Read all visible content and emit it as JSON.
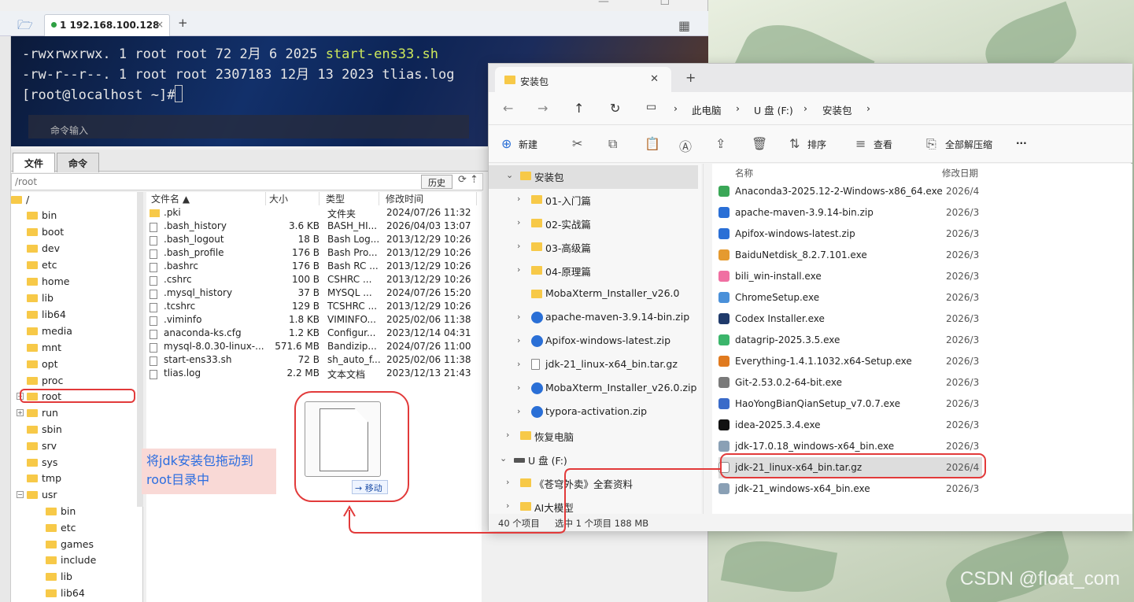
{
  "moba": {
    "tab_title": "1 192.168.100.128",
    "terminal_lines": [
      {
        "perm": "-rwxrwxrwx.",
        "links": "1",
        "user": "root",
        "group": "root",
        "size": "72",
        "month": "2月",
        "day": "6",
        "year": "2025",
        "name": "start-ens33.sh"
      },
      {
        "perm": "-rw-r--r--.",
        "links": "1",
        "user": "root",
        "group": "root",
        "size": "2307183",
        "month": "12月",
        "day": "13",
        "year": "2023",
        "name": "tlias.log"
      }
    ],
    "prompt": "[root@localhost ~]#",
    "command_input": "命令输入",
    "lower_tabs": [
      "文件",
      "命令"
    ],
    "path": "/root",
    "history_button": "历史",
    "tree": [
      "/",
      "bin",
      "boot",
      "dev",
      "etc",
      "home",
      "lib",
      "lib64",
      "media",
      "mnt",
      "opt",
      "proc",
      "root",
      "run",
      "sbin",
      "srv",
      "sys",
      "tmp",
      "usr",
      "bin",
      "etc",
      "games",
      "include",
      "lib",
      "lib64"
    ],
    "file_headers": [
      "文件名 ▲",
      "大小",
      "类型",
      "修改时间"
    ],
    "files": [
      {
        "name": ".pki",
        "size": "",
        "type": "文件夹",
        "time": "2024/07/26 11:32"
      },
      {
        "name": ".bash_history",
        "size": "3.6 KB",
        "type": "BASH_HI...",
        "time": "2026/04/03 13:07"
      },
      {
        "name": ".bash_logout",
        "size": "18 B",
        "type": "Bash Log...",
        "time": "2013/12/29 10:26"
      },
      {
        "name": ".bash_profile",
        "size": "176 B",
        "type": "Bash Pro...",
        "time": "2013/12/29 10:26"
      },
      {
        "name": ".bashrc",
        "size": "176 B",
        "type": "Bash RC ...",
        "time": "2013/12/29 10:26"
      },
      {
        "name": ".cshrc",
        "size": "100 B",
        "type": "CSHRC ...",
        "time": "2013/12/29 10:26"
      },
      {
        "name": ".mysql_history",
        "size": "37 B",
        "type": "MYSQL ...",
        "time": "2024/07/26 15:20"
      },
      {
        "name": ".tcshrc",
        "size": "129 B",
        "type": "TCSHRC ...",
        "time": "2013/12/29 10:26"
      },
      {
        "name": ".viminfo",
        "size": "1.8 KB",
        "type": "VIMINFO...",
        "time": "2025/02/06 11:38"
      },
      {
        "name": "anaconda-ks.cfg",
        "size": "1.2 KB",
        "type": "Configur...",
        "time": "2023/12/14 04:31"
      },
      {
        "name": "mysql-8.0.30-linux-...",
        "size": "571.6 MB",
        "type": "Bandizip...",
        "time": "2024/07/26 11:00"
      },
      {
        "name": "start-ens33.sh",
        "size": "72 B",
        "type": "sh_auto_f...",
        "time": "2025/02/06 11:38"
      },
      {
        "name": "tlias.log",
        "size": "2.2 MB",
        "type": "文本文档",
        "time": "2023/12/13 21:43"
      }
    ],
    "move_label": "→ 移动"
  },
  "annotation": {
    "line1": "将jdk安装包拖动到",
    "line2": "root目录中"
  },
  "explorer": {
    "tab_title": "安装包",
    "breadcrumb": [
      "此电脑",
      "U 盘 (F:)",
      "安装包"
    ],
    "toolbar": {
      "new": "新建",
      "sort": "排序",
      "view": "查看",
      "extract": "全部解压缩",
      "more": "···"
    },
    "nav": [
      {
        "label": "安装包",
        "level": 0
      },
      {
        "label": "01-入门篇",
        "level": 1
      },
      {
        "label": "02-实战篇",
        "level": 1
      },
      {
        "label": "03-高级篇",
        "level": 1
      },
      {
        "label": "04-原理篇",
        "level": 1
      },
      {
        "label": "MobaXterm_Installer_v26.0",
        "level": 1
      },
      {
        "label": "apache-maven-3.9.14-bin.zip",
        "level": 1
      },
      {
        "label": "Apifox-windows-latest.zip",
        "level": 1
      },
      {
        "label": "jdk-21_linux-x64_bin.tar.gz",
        "level": 1
      },
      {
        "label": "MobaXterm_Installer_v26.0.zip",
        "level": 1
      },
      {
        "label": "typora-activation.zip",
        "level": 1
      },
      {
        "label": "恢复电脑",
        "level": 0
      },
      {
        "label": "U 盘 (F:)",
        "level": -1
      },
      {
        "label": "《苍穹外卖》全套资料",
        "level": 0
      },
      {
        "label": "AI大模型",
        "level": 0
      }
    ],
    "headers": {
      "name": "名称",
      "date": "修改日期"
    },
    "files": [
      {
        "name": "Anaconda3-2025.12-2-Windows-x86_64.exe",
        "date": "2026/4",
        "color": "#3aa757"
      },
      {
        "name": "apache-maven-3.9.14-bin.zip",
        "date": "2026/3",
        "color": "#2a6fd6"
      },
      {
        "name": "Apifox-windows-latest.zip",
        "date": "2026/3",
        "color": "#2a6fd6"
      },
      {
        "name": "BaiduNetdisk_8.2.7.101.exe",
        "date": "2026/3",
        "color": "#e59a2f"
      },
      {
        "name": "bili_win-install.exe",
        "date": "2026/3",
        "color": "#f06fa2"
      },
      {
        "name": "ChromeSetup.exe",
        "date": "2026/3",
        "color": "#4a90d9"
      },
      {
        "name": "Codex Installer.exe",
        "date": "2026/3",
        "color": "#1f3a6b"
      },
      {
        "name": "datagrip-2025.3.5.exe",
        "date": "2026/3",
        "color": "#3bb56b"
      },
      {
        "name": "Everything-1.4.1.1032.x64-Setup.exe",
        "date": "2026/3",
        "color": "#e07a1f"
      },
      {
        "name": "Git-2.53.0.2-64-bit.exe",
        "date": "2026/3",
        "color": "#7a7a7a"
      },
      {
        "name": "HaoYongBianQianSetup_v7.0.7.exe",
        "date": "2026/3",
        "color": "#3a6bc9"
      },
      {
        "name": "idea-2025.3.4.exe",
        "date": "2026/3",
        "color": "#111111"
      },
      {
        "name": "jdk-17.0.18_windows-x64_bin.exe",
        "date": "2026/3",
        "color": "#8aa0b5"
      },
      {
        "name": "jdk-21_linux-x64_bin.tar.gz",
        "date": "2026/4",
        "color": "#ffffff"
      },
      {
        "name": "jdk-21_windows-x64_bin.exe",
        "date": "2026/3",
        "color": "#8aa0b5"
      }
    ],
    "status": {
      "count": "40 个项目",
      "selected": "选中 1 个项目  188 MB"
    }
  },
  "watermark": "CSDN @float_com"
}
